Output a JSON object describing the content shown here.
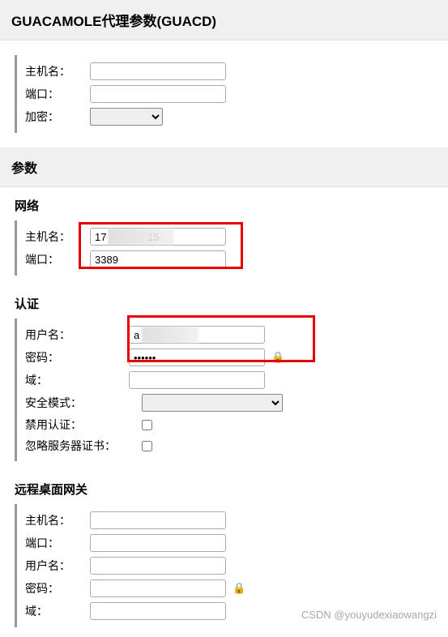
{
  "sections": {
    "guacd": {
      "title": "GUACAMOLE代理参数(GUACD)",
      "hostname_label": "主机名：",
      "port_label": "端口：",
      "encryption_label": "加密：",
      "hostname_value": "",
      "port_value": "",
      "encryption_value": ""
    },
    "params_title": "参数",
    "network": {
      "heading": "网络",
      "hostname_label": "主机名：",
      "port_label": "端口：",
      "hostname_value": "17              15",
      "port_value": "3389"
    },
    "auth": {
      "heading": "认证",
      "username_label": "用户名：",
      "password_label": "密码：",
      "domain_label": "域：",
      "security_label": "安全模式：",
      "disable_auth_label": "禁用认证：",
      "ignore_cert_label": "忽略服务器证书：",
      "username_value": "a",
      "password_value": "••••••",
      "domain_value": "",
      "security_value": "",
      "disable_auth_value": false,
      "ignore_cert_value": false
    },
    "gateway": {
      "heading": "远程桌面网关",
      "hostname_label": "主机名：",
      "port_label": "端口：",
      "username_label": "用户名：",
      "password_label": "密码：",
      "domain_label": "域：",
      "hostname_value": "",
      "port_value": "",
      "username_value": "",
      "password_value": "",
      "domain_value": ""
    }
  },
  "watermark": "CSDN @youyudexiaowangzi"
}
